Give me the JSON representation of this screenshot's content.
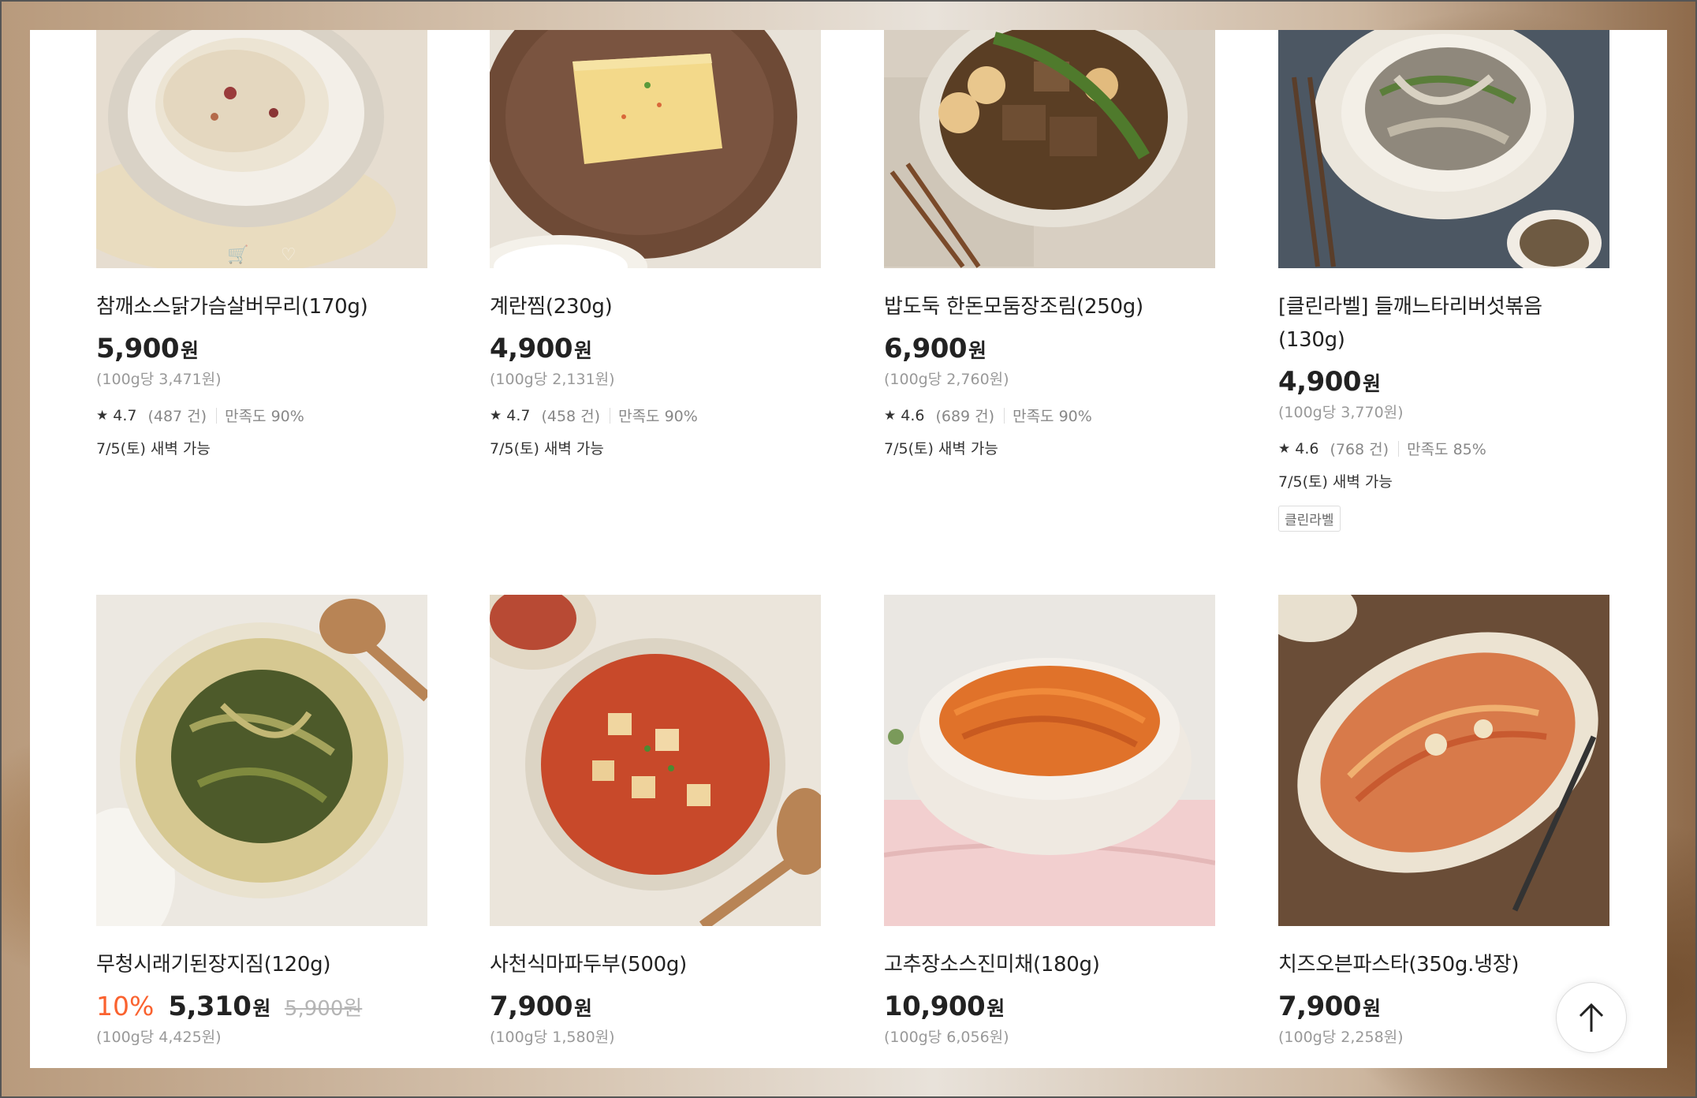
{
  "colors": {
    "accent_discount": "#fa622f",
    "text_primary": "#222222",
    "text_secondary": "#999999"
  },
  "icons": {
    "rating": "star-icon",
    "scroll_top": "arrow-up-icon",
    "cart": "cart-icon",
    "wishlist": "heart-icon"
  },
  "products": [
    {
      "name": "참깨소스닭가슴살버무리(170g)",
      "price": "5,900",
      "won": "원",
      "unit_price": "(100g당 3,471원)",
      "rating": "4.7",
      "reviews": "(487 건)",
      "satisfaction": "만족도 90%",
      "delivery": "7/5(토) 새벽 가능"
    },
    {
      "name": "계란찜(230g)",
      "price": "4,900",
      "won": "원",
      "unit_price": "(100g당 2,131원)",
      "rating": "4.7",
      "reviews": "(458 건)",
      "satisfaction": "만족도 90%",
      "delivery": "7/5(토) 새벽 가능"
    },
    {
      "name": "밥도둑 한돈모둠장조림(250g)",
      "price": "6,900",
      "won": "원",
      "unit_price": "(100g당 2,760원)",
      "rating": "4.6",
      "reviews": "(689 건)",
      "satisfaction": "만족도 90%",
      "delivery": "7/5(토) 새벽 가능"
    },
    {
      "name": "[클린라벨] 들깨느타리버섯볶음 (130g)",
      "price": "4,900",
      "won": "원",
      "unit_price": "(100g당 3,770원)",
      "rating": "4.6",
      "reviews": "(768 건)",
      "satisfaction": "만족도 85%",
      "delivery": "7/5(토) 새벽 가능",
      "tag": "클린라벨"
    },
    {
      "name": "무청시래기된장지짐(120g)",
      "discount": "10%",
      "price": "5,310",
      "won": "원",
      "original_price": "5,900원",
      "unit_price": "(100g당 4,425원)"
    },
    {
      "name": "사천식마파두부(500g)",
      "price": "7,900",
      "won": "원",
      "unit_price": "(100g당 1,580원)"
    },
    {
      "name": "고추장소스진미채(180g)",
      "price": "10,900",
      "won": "원",
      "unit_price": "(100g당 6,056원)"
    },
    {
      "name": "치즈오븐파스타(350g.냉장)",
      "price": "7,900",
      "won": "원",
      "unit_price": "(100g당 2,258원)"
    }
  ]
}
